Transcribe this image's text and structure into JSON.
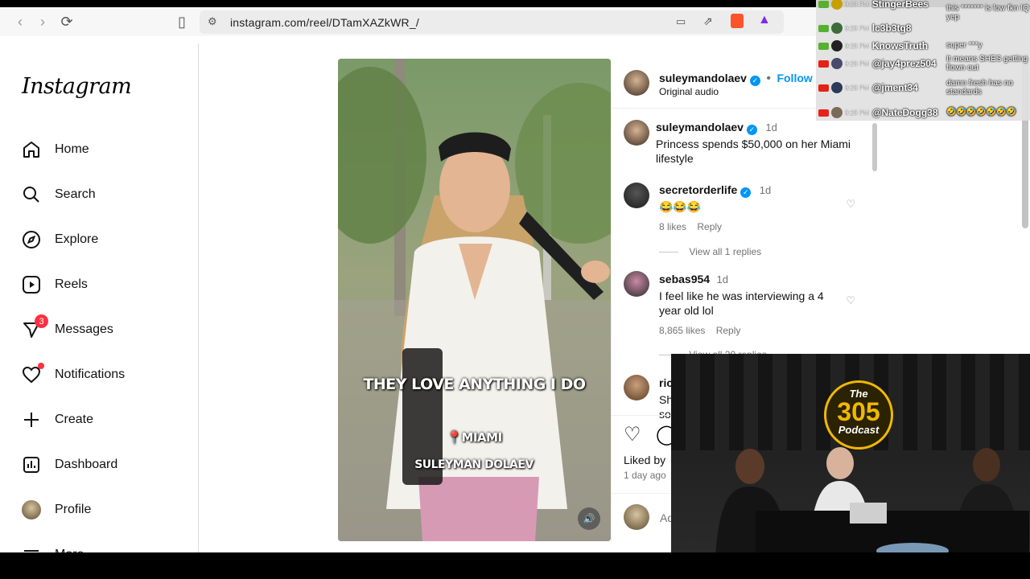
{
  "browser": {
    "url": "instagram.com/reel/DTamXAZkWR_/"
  },
  "sidebar": {
    "logo": "Instagram",
    "items": [
      {
        "label": "Home",
        "icon": "home-icon"
      },
      {
        "label": "Search",
        "icon": "search-icon"
      },
      {
        "label": "Explore",
        "icon": "compass-icon"
      },
      {
        "label": "Reels",
        "icon": "reels-icon"
      },
      {
        "label": "Messages",
        "icon": "messenger-icon",
        "badge": "3"
      },
      {
        "label": "Notifications",
        "icon": "heart-icon"
      },
      {
        "label": "Create",
        "icon": "plus-icon"
      },
      {
        "label": "Dashboard",
        "icon": "dashboard-icon"
      },
      {
        "label": "Profile",
        "icon": "profile-avatar"
      },
      {
        "label": "More",
        "icon": "menu-icon"
      }
    ]
  },
  "video": {
    "caption_1": "THEY LOVE ANYTHING I DO",
    "caption_2": "📍MIAMI",
    "caption_3": "SULEYMAN DOLAEV"
  },
  "post": {
    "author": "suleymandolaev",
    "follow": "Follow",
    "audio": "Original audio",
    "caption_time": "1d",
    "caption": "Princess spends $50,000 on her Miami lifestyle",
    "comments": [
      {
        "user": "secretorderlife",
        "verified": true,
        "time": "1d",
        "text": "😂😂😂",
        "likes": "8 likes",
        "reply": "Reply",
        "view_replies": "View all 1 replies"
      },
      {
        "user": "sebas954",
        "verified": false,
        "time": "1d",
        "text": "I feel like he was interviewing a 4 year old lol",
        "likes": "8,865 likes",
        "reply": "Reply",
        "view_replies": "View all 20 replies"
      },
      {
        "user": "ric",
        "text": "Sh",
        "text2": "so"
      }
    ],
    "liked_by": "Liked by",
    "age": "1 day ago",
    "add_comment": "Ad"
  },
  "chat": {
    "header": "StingerBees",
    "header_time": "9:28 PM",
    "messages": [
      {
        "name": "lc3b3tg8",
        "time": "9:28 PM",
        "text": "this ******* is low fkn IQ yep"
      },
      {
        "name": "KnowsTruth",
        "time": "9:28 PM",
        "text": "super ***y"
      },
      {
        "name": "@jay4prez504",
        "time": "9:28 PM",
        "text": "It means SHES getting flown out"
      },
      {
        "name": "@jment34",
        "time": "9:28 PM",
        "text": "damn fresh has no standards"
      },
      {
        "name": "@NateDogg38",
        "time": "9:28 PM",
        "text": "🤣🤣🤣🤣🤣🤣🤣"
      }
    ]
  },
  "webcam": {
    "logo_line1": "The",
    "logo_line2": "305",
    "logo_line3": "Podcast"
  },
  "colors": {
    "accent": "#0095f6",
    "badge": "#ff3040"
  }
}
